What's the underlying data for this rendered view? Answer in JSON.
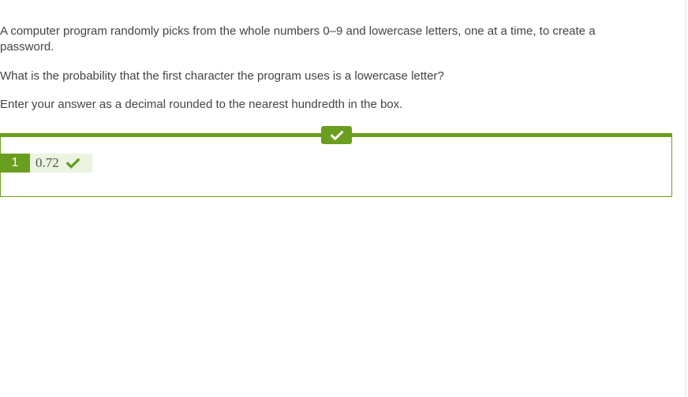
{
  "question": {
    "line1": "A computer program randomly picks from the whole numbers 0–9 and lowercase letters, one at a time, to create a password.",
    "line2": "What is the probability that the first character the program uses is a lowercase letter?",
    "line3": "Enter your answer as a decimal rounded to the nearest hundredth in the box."
  },
  "answer": {
    "index": "1",
    "value": "0.72",
    "status_icon": "checkmark-icon"
  },
  "status": {
    "icon": "checkmark-icon",
    "color": "#6a9e1f"
  }
}
